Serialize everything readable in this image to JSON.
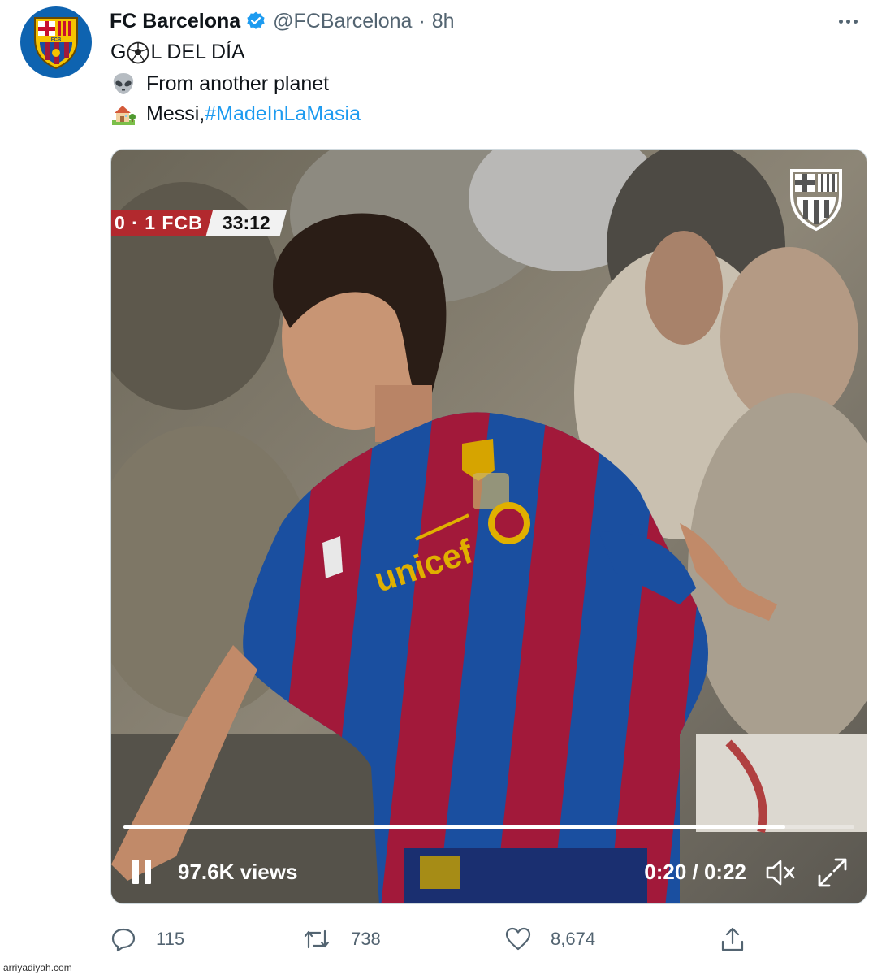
{
  "tweet": {
    "display_name": "FC Barcelona",
    "handle": "@FCBarcelona",
    "separator": "·",
    "time": "8h",
    "line1_before": "G",
    "line1_after": "L DEL DÍA",
    "line2": "From another planet",
    "line3_text": "Messi, ",
    "line3_hashtag": "#MadeInLaMasia"
  },
  "video": {
    "score": "0 · 1 FCB",
    "clock": "33:12",
    "views": "97.6K views",
    "time_display": "0:20 / 0:22",
    "progress": 0.906
  },
  "actions": {
    "replies": "115",
    "retweets": "738",
    "likes": "8,674"
  },
  "icons": {
    "avatar": "fc-barcelona-crest",
    "verified": "verified-badge-icon",
    "line1": "soccer-ball-emoji",
    "line2": "alien-emoji",
    "line3": "house-with-garden-emoji"
  },
  "colors": {
    "accent": "#1d9bf0",
    "blaugrana_blue": "#1a4fa0",
    "blaugrana_red": "#a2193a"
  },
  "watermark": "arriyadiyah.com"
}
